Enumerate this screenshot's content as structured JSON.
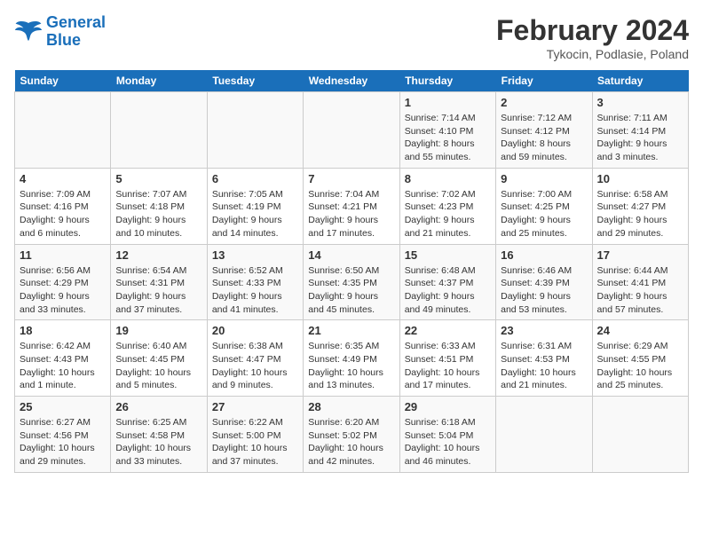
{
  "header": {
    "logo_line1": "General",
    "logo_line2": "Blue",
    "title": "February 2024",
    "subtitle": "Tykocin, Podlasie, Poland"
  },
  "weekdays": [
    "Sunday",
    "Monday",
    "Tuesday",
    "Wednesday",
    "Thursday",
    "Friday",
    "Saturday"
  ],
  "weeks": [
    [
      {
        "day": "",
        "detail": ""
      },
      {
        "day": "",
        "detail": ""
      },
      {
        "day": "",
        "detail": ""
      },
      {
        "day": "",
        "detail": ""
      },
      {
        "day": "1",
        "detail": "Sunrise: 7:14 AM\nSunset: 4:10 PM\nDaylight: 8 hours\nand 55 minutes."
      },
      {
        "day": "2",
        "detail": "Sunrise: 7:12 AM\nSunset: 4:12 PM\nDaylight: 8 hours\nand 59 minutes."
      },
      {
        "day": "3",
        "detail": "Sunrise: 7:11 AM\nSunset: 4:14 PM\nDaylight: 9 hours\nand 3 minutes."
      }
    ],
    [
      {
        "day": "4",
        "detail": "Sunrise: 7:09 AM\nSunset: 4:16 PM\nDaylight: 9 hours\nand 6 minutes."
      },
      {
        "day": "5",
        "detail": "Sunrise: 7:07 AM\nSunset: 4:18 PM\nDaylight: 9 hours\nand 10 minutes."
      },
      {
        "day": "6",
        "detail": "Sunrise: 7:05 AM\nSunset: 4:19 PM\nDaylight: 9 hours\nand 14 minutes."
      },
      {
        "day": "7",
        "detail": "Sunrise: 7:04 AM\nSunset: 4:21 PM\nDaylight: 9 hours\nand 17 minutes."
      },
      {
        "day": "8",
        "detail": "Sunrise: 7:02 AM\nSunset: 4:23 PM\nDaylight: 9 hours\nand 21 minutes."
      },
      {
        "day": "9",
        "detail": "Sunrise: 7:00 AM\nSunset: 4:25 PM\nDaylight: 9 hours\nand 25 minutes."
      },
      {
        "day": "10",
        "detail": "Sunrise: 6:58 AM\nSunset: 4:27 PM\nDaylight: 9 hours\nand 29 minutes."
      }
    ],
    [
      {
        "day": "11",
        "detail": "Sunrise: 6:56 AM\nSunset: 4:29 PM\nDaylight: 9 hours\nand 33 minutes."
      },
      {
        "day": "12",
        "detail": "Sunrise: 6:54 AM\nSunset: 4:31 PM\nDaylight: 9 hours\nand 37 minutes."
      },
      {
        "day": "13",
        "detail": "Sunrise: 6:52 AM\nSunset: 4:33 PM\nDaylight: 9 hours\nand 41 minutes."
      },
      {
        "day": "14",
        "detail": "Sunrise: 6:50 AM\nSunset: 4:35 PM\nDaylight: 9 hours\nand 45 minutes."
      },
      {
        "day": "15",
        "detail": "Sunrise: 6:48 AM\nSunset: 4:37 PM\nDaylight: 9 hours\nand 49 minutes."
      },
      {
        "day": "16",
        "detail": "Sunrise: 6:46 AM\nSunset: 4:39 PM\nDaylight: 9 hours\nand 53 minutes."
      },
      {
        "day": "17",
        "detail": "Sunrise: 6:44 AM\nSunset: 4:41 PM\nDaylight: 9 hours\nand 57 minutes."
      }
    ],
    [
      {
        "day": "18",
        "detail": "Sunrise: 6:42 AM\nSunset: 4:43 PM\nDaylight: 10 hours\nand 1 minute."
      },
      {
        "day": "19",
        "detail": "Sunrise: 6:40 AM\nSunset: 4:45 PM\nDaylight: 10 hours\nand 5 minutes."
      },
      {
        "day": "20",
        "detail": "Sunrise: 6:38 AM\nSunset: 4:47 PM\nDaylight: 10 hours\nand 9 minutes."
      },
      {
        "day": "21",
        "detail": "Sunrise: 6:35 AM\nSunset: 4:49 PM\nDaylight: 10 hours\nand 13 minutes."
      },
      {
        "day": "22",
        "detail": "Sunrise: 6:33 AM\nSunset: 4:51 PM\nDaylight: 10 hours\nand 17 minutes."
      },
      {
        "day": "23",
        "detail": "Sunrise: 6:31 AM\nSunset: 4:53 PM\nDaylight: 10 hours\nand 21 minutes."
      },
      {
        "day": "24",
        "detail": "Sunrise: 6:29 AM\nSunset: 4:55 PM\nDaylight: 10 hours\nand 25 minutes."
      }
    ],
    [
      {
        "day": "25",
        "detail": "Sunrise: 6:27 AM\nSunset: 4:56 PM\nDaylight: 10 hours\nand 29 minutes."
      },
      {
        "day": "26",
        "detail": "Sunrise: 6:25 AM\nSunset: 4:58 PM\nDaylight: 10 hours\nand 33 minutes."
      },
      {
        "day": "27",
        "detail": "Sunrise: 6:22 AM\nSunset: 5:00 PM\nDaylight: 10 hours\nand 37 minutes."
      },
      {
        "day": "28",
        "detail": "Sunrise: 6:20 AM\nSunset: 5:02 PM\nDaylight: 10 hours\nand 42 minutes."
      },
      {
        "day": "29",
        "detail": "Sunrise: 6:18 AM\nSunset: 5:04 PM\nDaylight: 10 hours\nand 46 minutes."
      },
      {
        "day": "",
        "detail": ""
      },
      {
        "day": "",
        "detail": ""
      }
    ]
  ]
}
